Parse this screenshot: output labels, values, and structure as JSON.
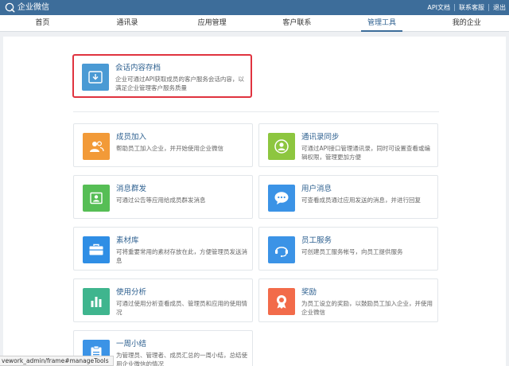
{
  "header": {
    "app_name": "企业微信",
    "links": [
      "API文档",
      "联系客服",
      "退出"
    ]
  },
  "nav": {
    "items": [
      "首页",
      "通讯录",
      "应用管理",
      "客户联系",
      "管理工具",
      "我的企业"
    ],
    "active_index": 4
  },
  "featured": {
    "title": "会话内容存档",
    "desc": "企业可通过API获取成员的客户服务会话内容，以满足企业管理客户服务质量",
    "icon": "archive-download-icon",
    "color": "#4a9ad4"
  },
  "cards": [
    {
      "title": "成员加入",
      "desc": "帮助员工加入企业，并开始使用企业微信",
      "icon": "members-icon",
      "color": "#f29a38"
    },
    {
      "title": "通讯录同步",
      "desc": "可通过API接口管理通讯录，同时可设置查看或编辑权限，管理更加方便",
      "icon": "contact-sync-icon",
      "color": "#8dc63f"
    },
    {
      "title": "消息群发",
      "desc": "可通过公告等应用给成员群发消息",
      "icon": "broadcast-icon",
      "color": "#56be55"
    },
    {
      "title": "用户消息",
      "desc": "可查看成员通过应用发送的消息，并进行回复",
      "icon": "chat-bubble-icon",
      "color": "#3b93e6"
    },
    {
      "title": "素材库",
      "desc": "可将重要常用的素材存放在此，方便管理员发送消息",
      "icon": "briefcase-icon",
      "color": "#2f8ee5"
    },
    {
      "title": "员工服务",
      "desc": "可创建员工服务帐号，向员工提供服务",
      "icon": "headset-icon",
      "color": "#3b93e6"
    },
    {
      "title": "使用分析",
      "desc": "可通过使用分析查看成员、管理员和应用的使用情况",
      "icon": "bar-chart-icon",
      "color": "#3fb58e"
    },
    {
      "title": "奖励",
      "desc": "为员工设立的奖励，以鼓励员工加入企业，并使用企业微信",
      "icon": "medal-icon",
      "color": "#f26b4a"
    },
    {
      "title": "一周小结",
      "desc": "为管理员、管理者、成员汇总的一周小结，总结使用企业微信的情况",
      "icon": "clipboard-icon",
      "color": "#3b93e6"
    }
  ],
  "statusbar": {
    "url": "vework_admin/frame#manageTools"
  }
}
